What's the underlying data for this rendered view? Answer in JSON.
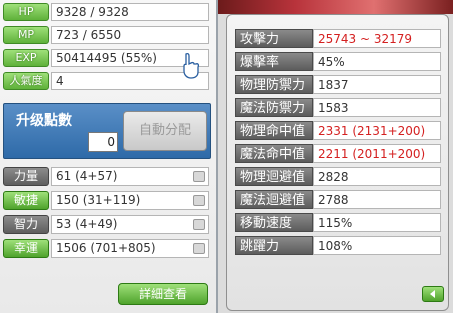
{
  "left_panel": {
    "hp": {
      "label": "HP",
      "value": "9328 / 9328"
    },
    "mp": {
      "label": "MP",
      "value": "723 / 6550"
    },
    "exp": {
      "label": "EXP",
      "value": "50414495 (55%)"
    },
    "fame": {
      "label": "人氣度",
      "value": "4"
    },
    "ap": {
      "title": "升级點數",
      "value": "0",
      "auto_button": "自動分配"
    },
    "stats": [
      {
        "label": "力量",
        "value": "61 (4+57)"
      },
      {
        "label": "敏捷",
        "value": "150 (31+119)"
      },
      {
        "label": "智力",
        "value": "53 (4+49)"
      },
      {
        "label": "幸運",
        "value": "1506 (701+805)"
      }
    ],
    "detail_button": "詳細查看"
  },
  "right_panel": {
    "rows": [
      {
        "label": "攻擊力",
        "value": "25743 ~ 32179",
        "highlight": true
      },
      {
        "label": "爆擊率",
        "value": "45%",
        "highlight": false
      },
      {
        "label": "物理防禦力",
        "value": "1837",
        "highlight": false
      },
      {
        "label": "魔法防禦力",
        "value": "1583",
        "highlight": false
      },
      {
        "label": "物理命中值",
        "value": "2331 (2131+200)",
        "highlight": true
      },
      {
        "label": "魔法命中值",
        "value": "2211 (2011+200)",
        "highlight": true
      },
      {
        "label": "物理迴避值",
        "value": "2828",
        "highlight": false
      },
      {
        "label": "魔法迴避值",
        "value": "2788",
        "highlight": false
      },
      {
        "label": "移動速度",
        "value": "115%",
        "highlight": false
      },
      {
        "label": "跳躍力",
        "value": "108%",
        "highlight": false
      }
    ]
  },
  "colors": {
    "highlight": "#d42020",
    "label_green": "#5fb13a",
    "label_grey": "#5e5e5e"
  }
}
